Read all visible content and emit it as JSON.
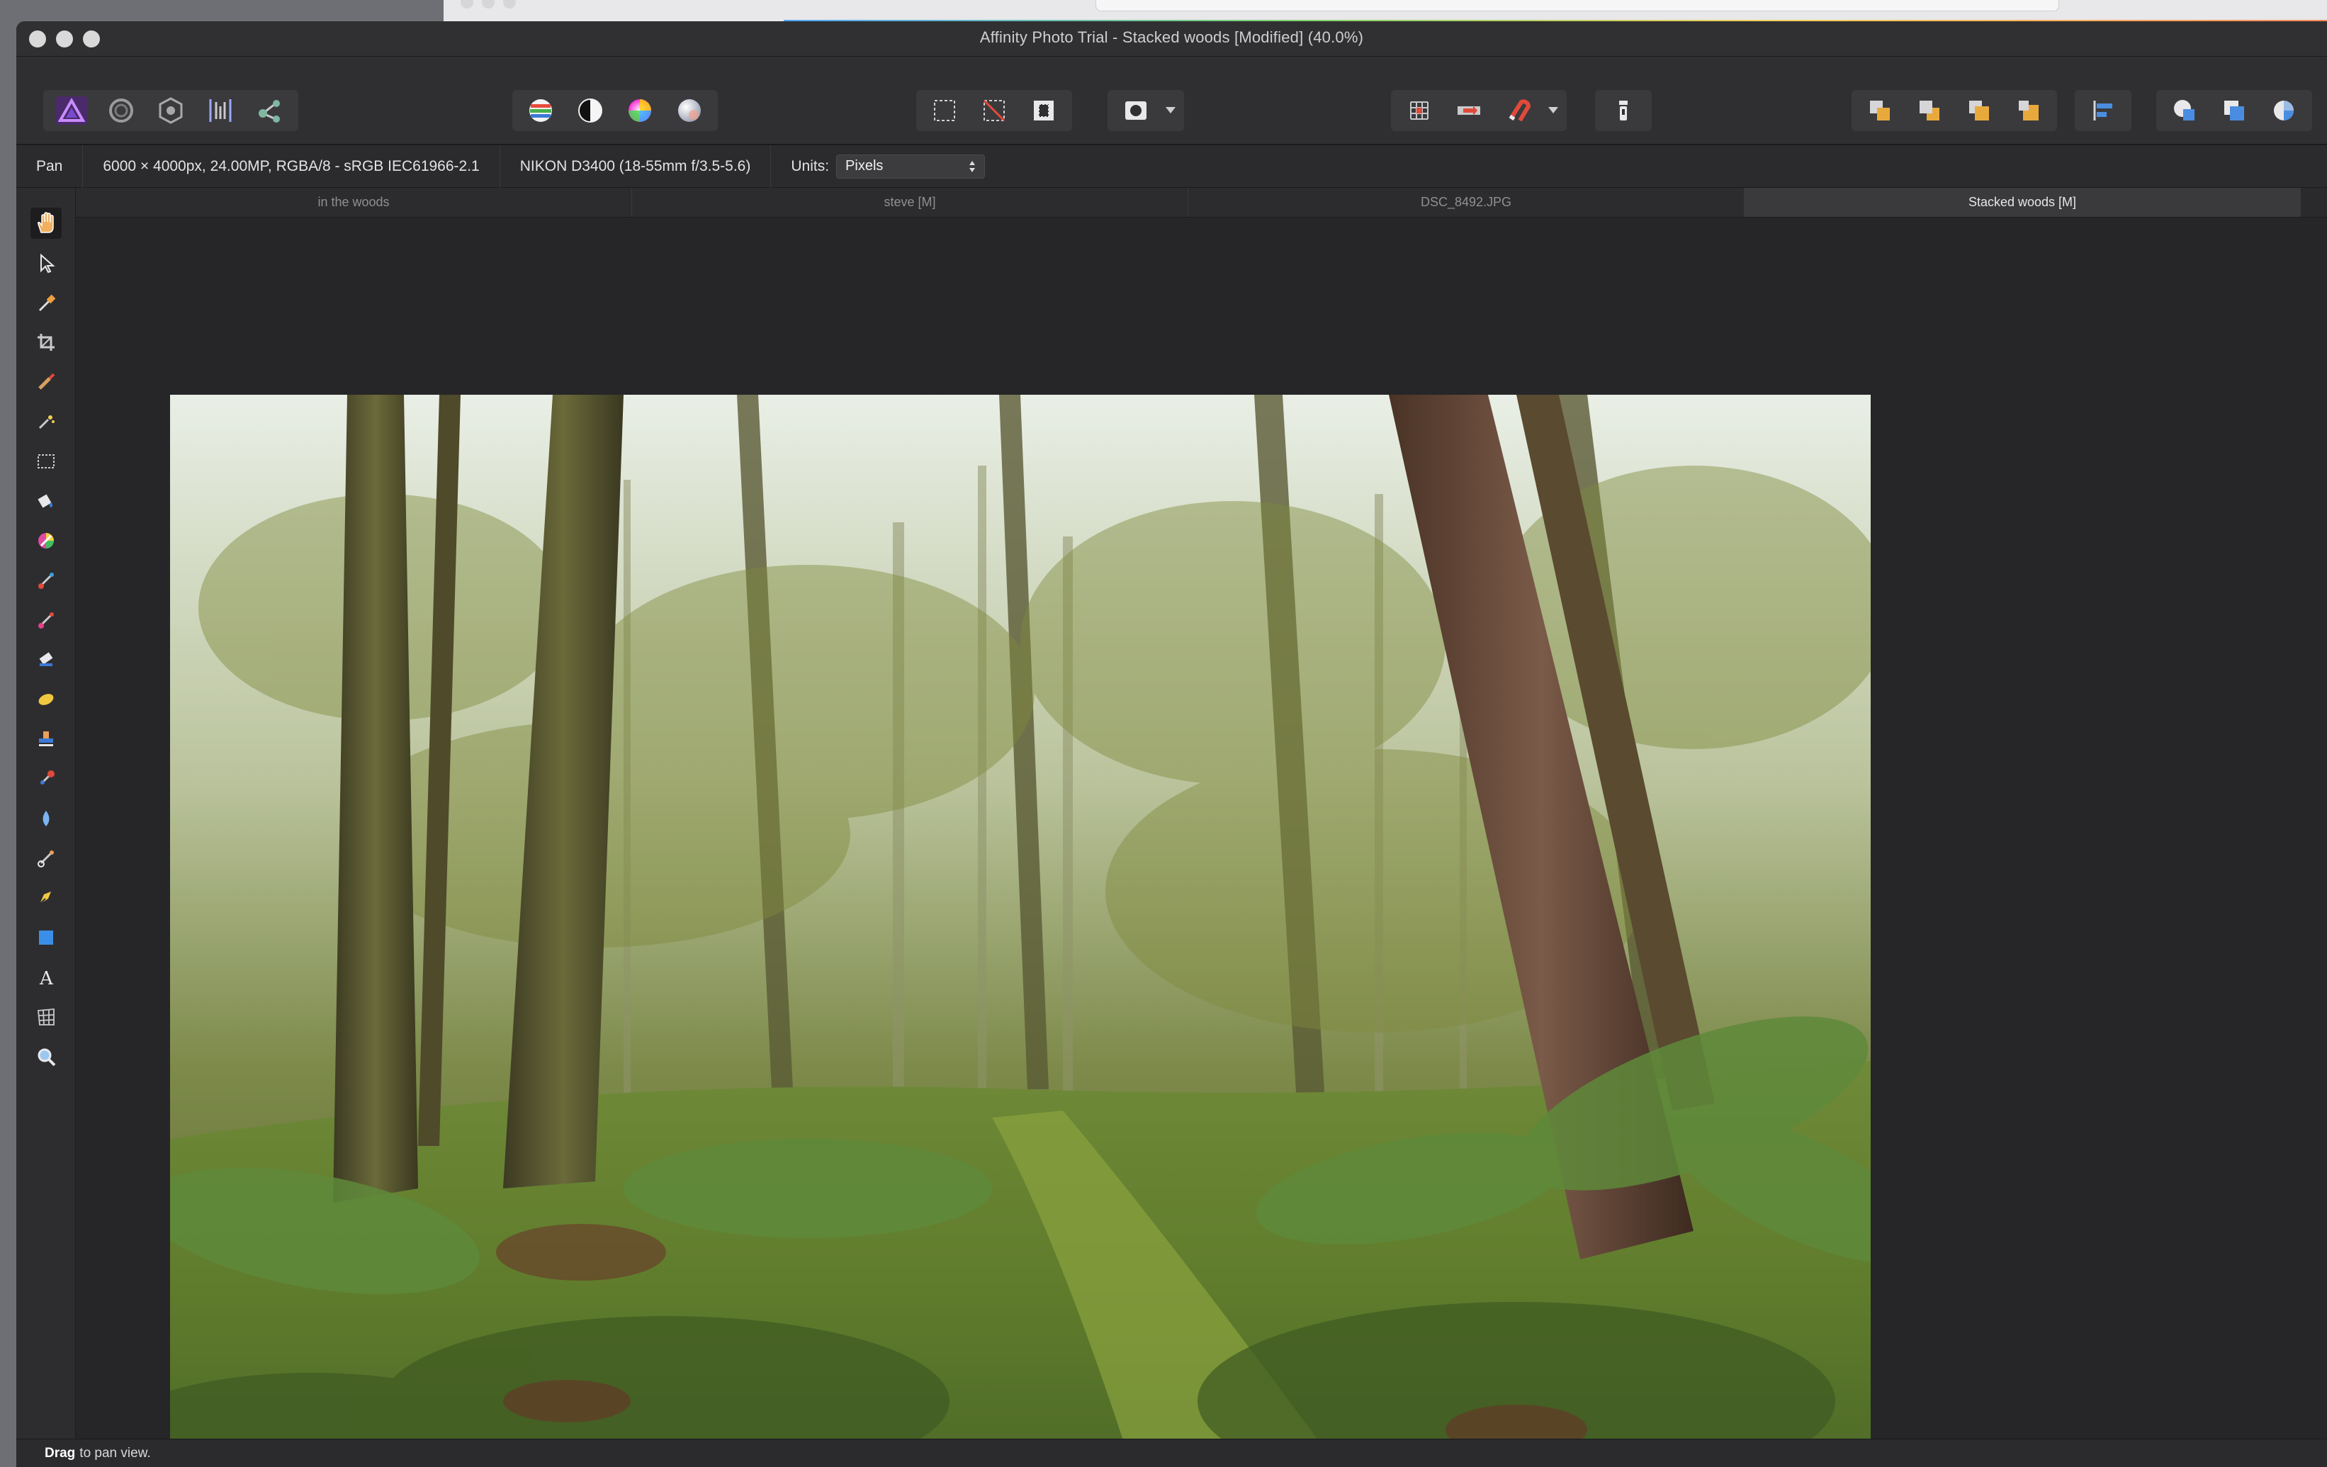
{
  "window": {
    "title": "Affinity Photo Trial - Stacked woods [Modified] (40.0%)"
  },
  "toolbar": {
    "persona_icons": [
      "photo-persona-icon",
      "liquify-persona-icon",
      "develop-persona-icon",
      "tone-mapping-persona-icon",
      "export-persona-icon"
    ],
    "adjust_icons": [
      "auto-levels-icon",
      "auto-contrast-icon",
      "auto-colors-icon",
      "auto-white-balance-icon"
    ],
    "selection_icons": [
      "select-all-icon",
      "deselect-icon",
      "invert-selection-icon"
    ],
    "mask_icons": [
      "quick-mask-icon"
    ],
    "snap_icons": [
      "grid-icon",
      "assistant-icon",
      "snapping-icon"
    ],
    "order_icons": [
      "move-back-icon",
      "move-forward-icon",
      "move-to-back-icon",
      "move-to-front-icon"
    ],
    "align_icons": [
      "align-icon"
    ],
    "boolean_icons": [
      "add-icon",
      "subtract-icon",
      "intersect-icon"
    ]
  },
  "context": {
    "tool": "Pan",
    "doc_info": "6000 × 4000px, 24.00MP, RGBA/8 - sRGB IEC61966-2.1",
    "camera": "NIKON D3400 (18-55mm f/3.5-5.6)",
    "units_label": "Units:",
    "units_value": "Pixels"
  },
  "tabs": [
    {
      "label": "in the woods"
    },
    {
      "label": "steve [M]"
    },
    {
      "label": "DSC_8492.JPG"
    },
    {
      "label": "Stacked woods [M]"
    }
  ],
  "status": {
    "bold": "Drag",
    "text": "to pan view."
  }
}
